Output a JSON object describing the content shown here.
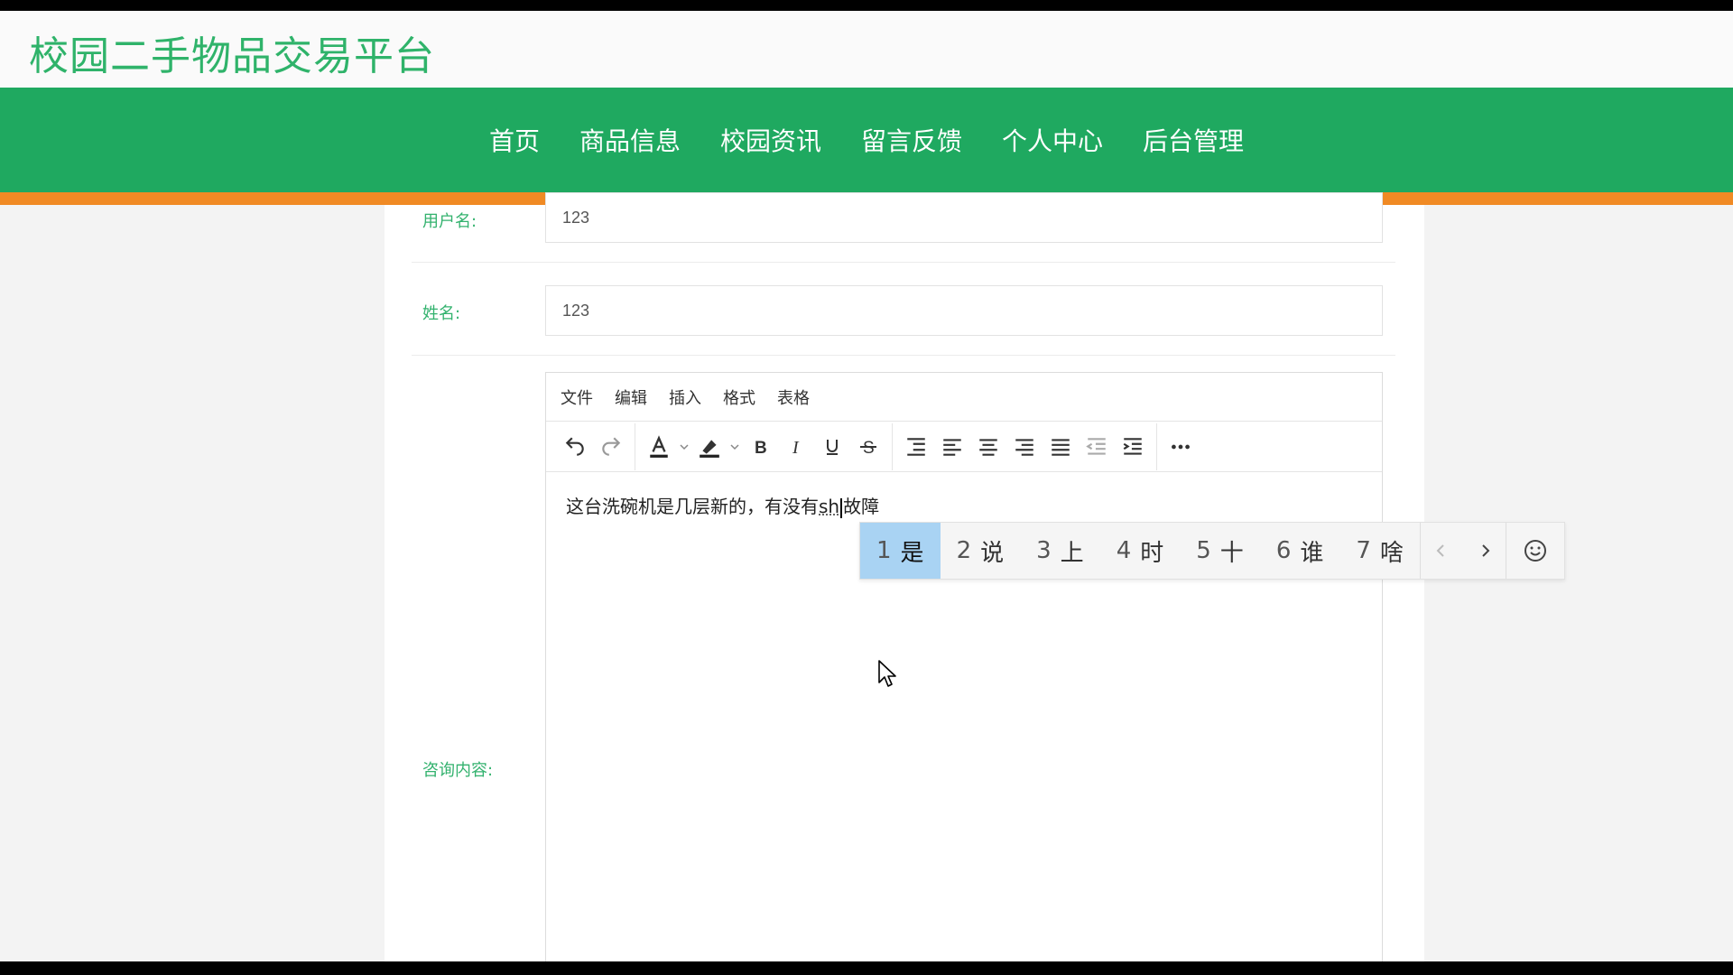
{
  "site": {
    "title": "校园二手物品交易平台"
  },
  "nav": {
    "items": [
      "首页",
      "商品信息",
      "校园资讯",
      "留言反馈",
      "个人中心",
      "后台管理"
    ]
  },
  "form": {
    "username_label": "用户名:",
    "username_value": "123",
    "name_label": "姓名:",
    "name_value": "123",
    "content_label": "咨询内容:"
  },
  "editor": {
    "menus": [
      "文件",
      "编辑",
      "插入",
      "格式",
      "表格"
    ],
    "text_before": "这台洗碗机是几层新的，有没有",
    "composing": "sh",
    "text_after": "故障"
  },
  "ime": {
    "candidates": [
      {
        "num": "1",
        "text": "是"
      },
      {
        "num": "2",
        "text": "说"
      },
      {
        "num": "3",
        "text": "上"
      },
      {
        "num": "4",
        "text": "时"
      },
      {
        "num": "5",
        "text": "十"
      },
      {
        "num": "6",
        "text": "谁"
      },
      {
        "num": "7",
        "text": "啥"
      }
    ],
    "selected_index": 0,
    "prev_icon": "chevron-left-icon",
    "next_icon": "chevron-right-icon",
    "emoji_icon": "smiley-icon"
  },
  "colors": {
    "brand_green": "#1fa960",
    "title_green": "#2fb36a",
    "accent_orange": "#f08a24",
    "candidate_highlight": "#a9d3f3"
  }
}
